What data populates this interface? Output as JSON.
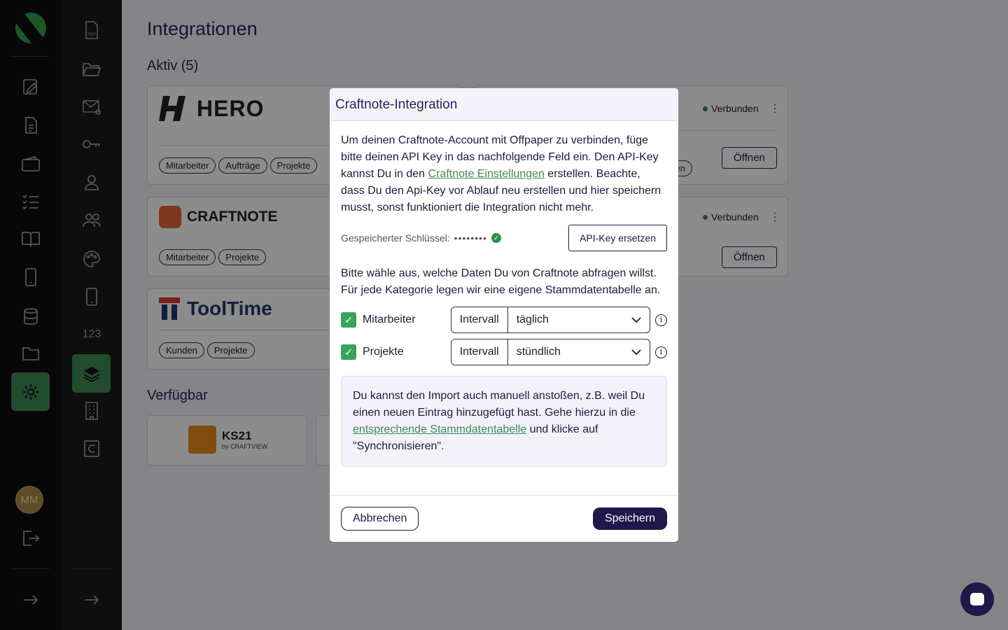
{
  "sidebar": {
    "avatar_initials": "MM"
  },
  "subsidebar": {
    "numbers_label": "123"
  },
  "main": {
    "title": "Integrationen",
    "active_section": "Aktiv (5)",
    "available_section": "Verfügbar",
    "cards": [
      {
        "name": "HERO",
        "chips": [
          "Mitarbeiter",
          "Aufträge",
          "Projekte"
        ]
      },
      {
        "name": "CRAFTNOTE",
        "chips": [
          "Mitarbeiter",
          "Projekte"
        ]
      },
      {
        "name": "ToolTime",
        "chips": [
          "Kunden",
          "Projekte"
        ]
      }
    ],
    "right_cards": [
      {
        "status": "Verbunden",
        "open": "Öffnen",
        "chip_fragment": "iten"
      },
      {
        "status": "Verbunden",
        "open": "Öffnen"
      }
    ],
    "available": [
      {
        "name": "KS21",
        "sub": "by CRAFTVIEW"
      }
    ]
  },
  "modal": {
    "title": "Craftnote-Integration",
    "intro_1": "Um deinen Craftnote-Account mit Offpaper zu verbinden, füge bitte deinen API Key in das nachfolgende Feld ein. Den API-Key kannst Du in den ",
    "intro_link": "Craftnote Einstellungen",
    "intro_2": " erstellen. Beachte, dass Du den Api-Key vor Ablauf neu erstellen und hier speichern musst, sonst funktioniert die Integration nicht mehr.",
    "key_label": "Gespeicherter Schlüssel:",
    "key_mask": "••••••••",
    "replace_key": "API-Key ersetzen",
    "choose_text": "Bitte wähle aus, welche Daten Du von Craftnote abfragen willst. Für jede Kategorie legen wir eine eigene Stammdatentabelle an.",
    "categories": [
      {
        "label": "Mitarbeiter",
        "prefix": "Intervall",
        "value": "täglich"
      },
      {
        "label": "Projekte",
        "prefix": "Intervall",
        "value": "stündlich"
      }
    ],
    "note_1": "Du kannst den Import auch manuell anstoßen, z.B. weil Du einen neuen Eintrag hinzugefügt hast. Gehe hierzu in die ",
    "note_link": "entsprechende Stammdatentabelle",
    "note_2": " und klicke auf \"Synchronisieren\".",
    "cancel": "Abbrechen",
    "save": "Speichern"
  },
  "colors": {
    "accent": "#3e8a55",
    "primary": "#21174a"
  }
}
